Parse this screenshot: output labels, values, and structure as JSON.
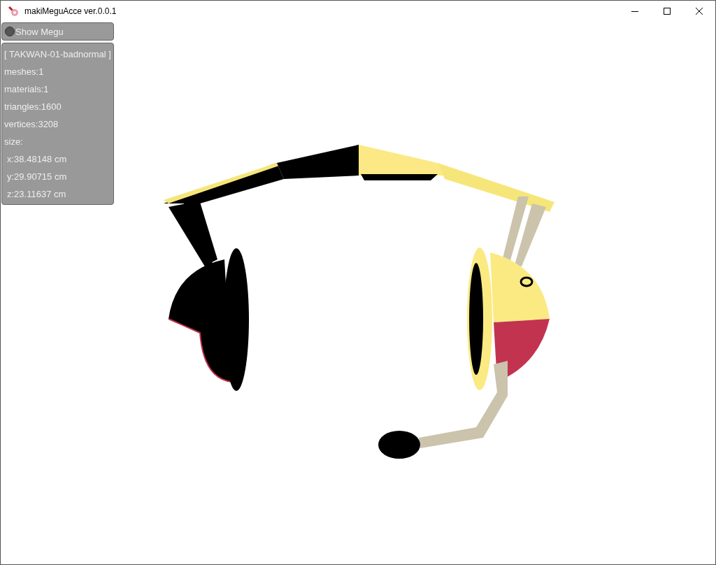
{
  "window": {
    "title": "makiMeguAcce ver.0.0.1"
  },
  "toggle": {
    "label": "Show Megu",
    "checked": false
  },
  "info_panel": {
    "lines": [
      {
        "text": "[ TAKWAN-01-badnormal ]",
        "indented": false
      },
      {
        "text": "meshes:1",
        "indented": false
      },
      {
        "text": "materials:1",
        "indented": false
      },
      {
        "text": "triangles:1600",
        "indented": false
      },
      {
        "text": "vertices:3208",
        "indented": false
      },
      {
        "text": "size:",
        "indented": false
      },
      {
        "text": "x:38.48148 cm",
        "indented": true
      },
      {
        "text": "y:29.90715 cm",
        "indented": true
      },
      {
        "text": "z:23.11637 cm",
        "indented": true
      }
    ]
  }
}
